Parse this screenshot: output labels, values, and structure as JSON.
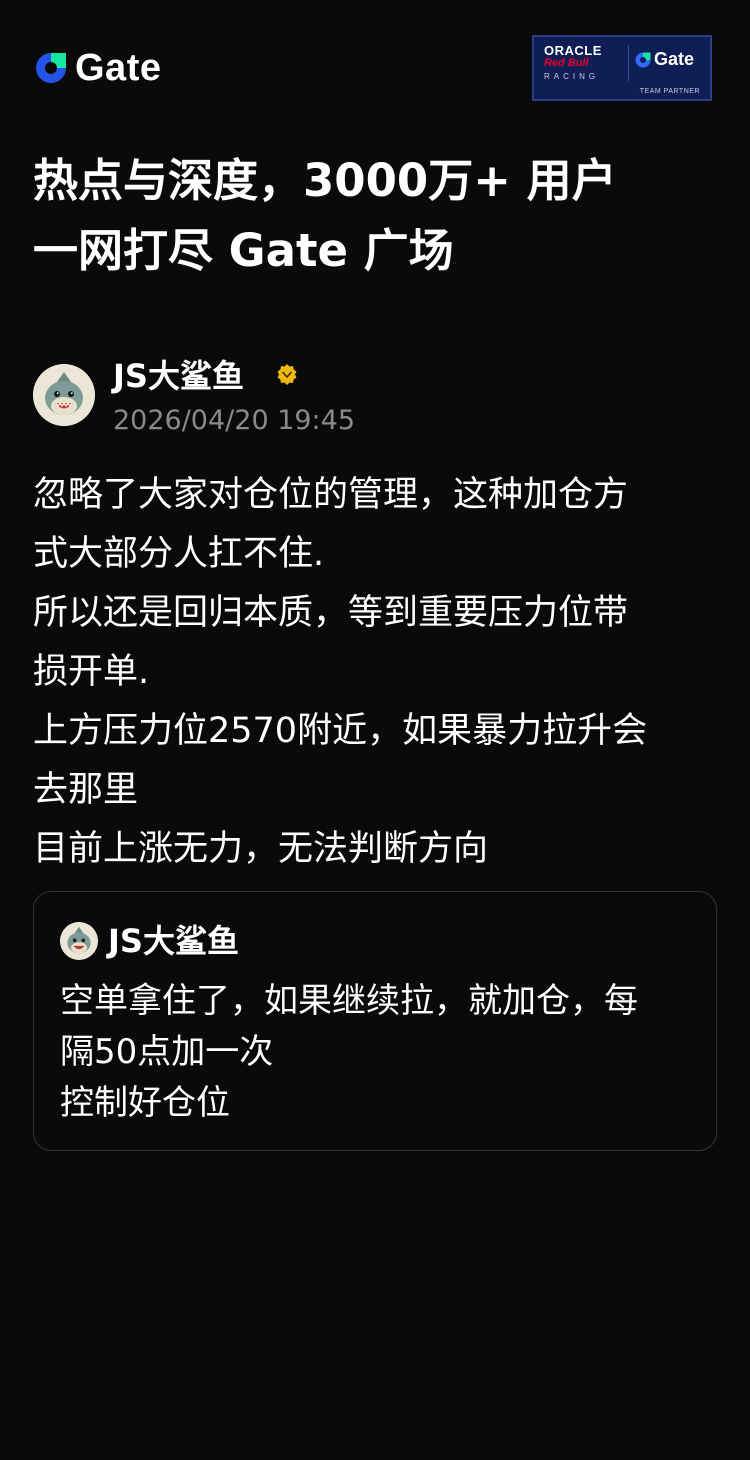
{
  "brand": {
    "logo_text": "Gate",
    "accent_color": "#2354e6",
    "accent_light": "#17e5a1"
  },
  "partner_badge": {
    "line1": "ORACLE",
    "line2": "Red Bull",
    "line3": "RACING",
    "brand": "Gate",
    "tag": "TEAM PARTNER"
  },
  "headline": {
    "line1": "热点与深度，3000万+ 用户",
    "line2": "一网打尽 Gate 广场"
  },
  "post": {
    "author_name": "JS大鲨鱼",
    "verified_icon": "verified-badge-icon",
    "timestamp": "2026/04/20 19:45",
    "body_lines": [
      "忽略了大家对仓位的管理，这种加仓方",
      "式大部分人扛不住.",
      "所以还是回归本质，等到重要压力位带",
      "损开单.",
      "上方压力位2570附近，如果暴力拉升会",
      "去那里",
      "目前上涨无力，无法判断方向"
    ]
  },
  "quoted_post": {
    "author_name": "JS大鲨鱼",
    "body_lines": [
      "空单拿住了，如果继续拉，就加仓，每",
      "隔50点加一次",
      "控制好仓位"
    ]
  }
}
